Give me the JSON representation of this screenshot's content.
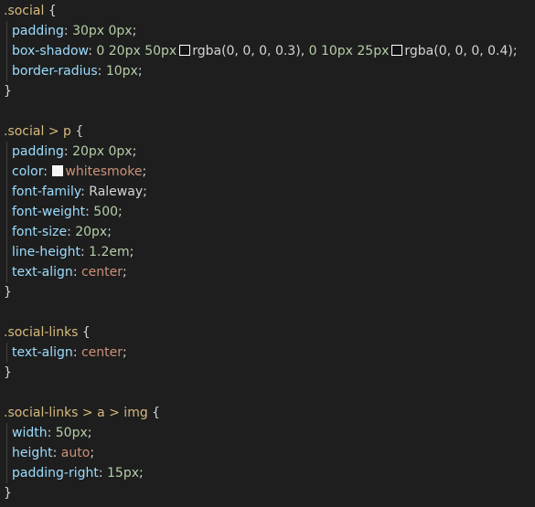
{
  "code": {
    "block1": {
      "selector": ".social",
      "open": " {",
      "padding_prop": "padding",
      "padding_val": "30px 0px",
      "shadow_prop": "box-shadow",
      "shadow_part1": "0 20px 50px",
      "shadow_color1": "rgba(0, 0, 0, 0.3)",
      "shadow_part2": "0 10px 25px",
      "shadow_color2": "rgba(0, 0, 0, 0.4)",
      "radius_prop": "border-radius",
      "radius_val": "10px",
      "close": "}"
    },
    "block2": {
      "selector": ".social > p",
      "open": " {",
      "padding_prop": "padding",
      "padding_val": "20px 0px",
      "color_prop": "color",
      "color_val": "whitesmoke",
      "family_prop": "font-family",
      "family_val": "Raleway",
      "weight_prop": "font-weight",
      "weight_val": "500",
      "size_prop": "font-size",
      "size_val": "20px",
      "lh_prop": "line-height",
      "lh_val": "1.2em",
      "align_prop": "text-align",
      "align_val": "center",
      "close": "}"
    },
    "block3": {
      "selector": ".social-links",
      "open": " {",
      "align_prop": "text-align",
      "align_val": "center",
      "close": "}"
    },
    "block4": {
      "selector": ".social-links > a > img",
      "open": " {",
      "width_prop": "width",
      "width_val": "50px",
      "height_prop": "height",
      "height_val": "auto",
      "pr_prop": "padding-right",
      "pr_val": "15px",
      "close": "}"
    }
  },
  "colors": {
    "background": "#1e1e1e",
    "selector": "#d7ba7d",
    "property": "#9cdcfe",
    "number": "#b5cea8",
    "keyword_value": "#ce9178",
    "punctuation": "#d4d4d4",
    "swatch_whitesmoke": "#f5f5f5"
  }
}
